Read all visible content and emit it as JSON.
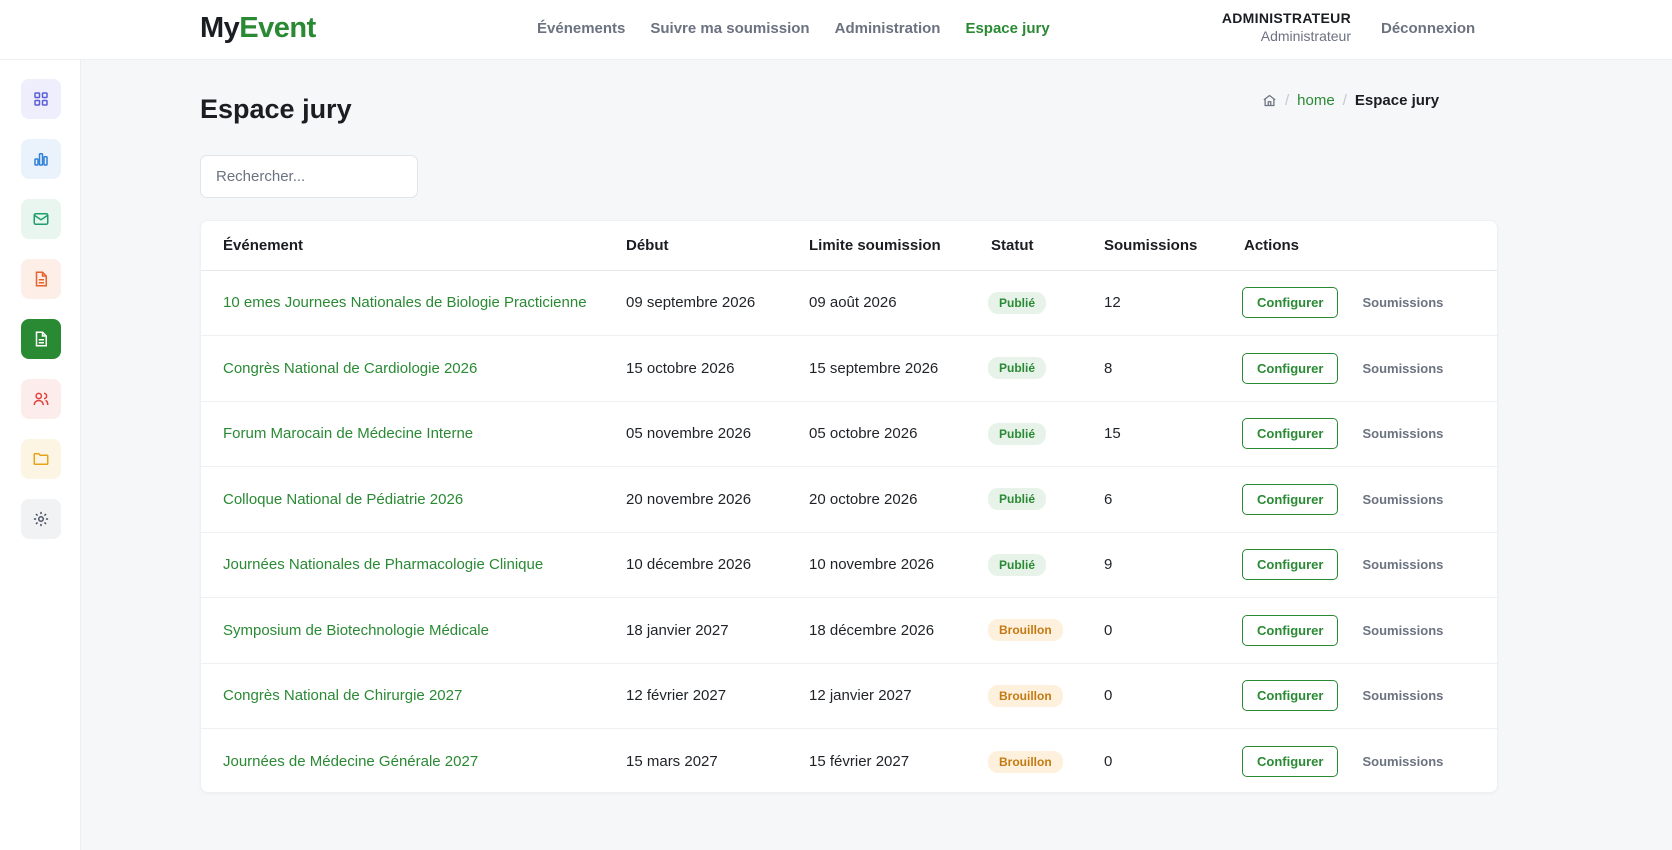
{
  "app": {
    "logo_part1": "My",
    "logo_part2": "Event"
  },
  "nav": {
    "items": [
      {
        "label": "Événements"
      },
      {
        "label": "Suivre ma soumission"
      },
      {
        "label": "Administration"
      },
      {
        "label": "Espace jury",
        "active": true
      }
    ]
  },
  "user": {
    "role_main": "ADMINISTRATEUR",
    "role_sub": "Administrateur",
    "logout": "Déconnexion"
  },
  "sidebar": {
    "items": [
      {
        "icon": "grid-icon",
        "color": "#5b5fd6",
        "bg": "#eeeefc"
      },
      {
        "icon": "bar-chart-icon",
        "color": "#2f80d8",
        "bg": "#eaf3fc"
      },
      {
        "icon": "mail-icon",
        "color": "#1e9e6a",
        "bg": "#e8f6ef"
      },
      {
        "icon": "document-icon",
        "color": "#e8622a",
        "bg": "#fdeee7"
      },
      {
        "icon": "document-icon",
        "color": "#ffffff",
        "bg": "#2a8a34",
        "active": true
      },
      {
        "icon": "users-icon",
        "color": "#e0403a",
        "bg": "#fdecec"
      },
      {
        "icon": "folder-icon",
        "color": "#e6a21a",
        "bg": "#fdf5e4"
      },
      {
        "icon": "gear-icon",
        "color": "#4b5563",
        "bg": "#f1f2f4"
      }
    ]
  },
  "page": {
    "title": "Espace jury"
  },
  "breadcrumb": {
    "home": "home",
    "current": "Espace jury"
  },
  "search": {
    "placeholder": "Rechercher..."
  },
  "table": {
    "headers": [
      "Événement",
      "Début",
      "Limite soumission",
      "Statut",
      "Soumissions",
      "Actions"
    ],
    "configure_label": "Configurer",
    "submissions_label": "Soumissions",
    "rows": [
      {
        "event": "10 emes Journees Nationales de Biologie Practicienne",
        "start": "09 septembre 2026",
        "deadline": "09 août 2026",
        "status": "Publié",
        "status_type": "pub",
        "submissions": "12"
      },
      {
        "event": "Congrès National de Cardiologie 2026",
        "start": "15 octobre 2026",
        "deadline": "15 septembre 2026",
        "status": "Publié",
        "status_type": "pub",
        "submissions": "8"
      },
      {
        "event": "Forum Marocain de Médecine Interne",
        "start": "05 novembre 2026",
        "deadline": "05 octobre 2026",
        "status": "Publié",
        "status_type": "pub",
        "submissions": "15"
      },
      {
        "event": "Colloque National de Pédiatrie 2026",
        "start": "20 novembre 2026",
        "deadline": "20 octobre 2026",
        "status": "Publié",
        "status_type": "pub",
        "submissions": "6"
      },
      {
        "event": "Journées Nationales de Pharmacologie Clinique",
        "start": "10 décembre 2026",
        "deadline": "10 novembre 2026",
        "status": "Publié",
        "status_type": "pub",
        "submissions": "9"
      },
      {
        "event": "Symposium de Biotechnologie Médicale",
        "start": "18 janvier 2027",
        "deadline": "18 décembre 2026",
        "status": "Brouillon",
        "status_type": "draft",
        "submissions": "0"
      },
      {
        "event": "Congrès National de Chirurgie 2027",
        "start": "12 février 2027",
        "deadline": "12 janvier 2027",
        "status": "Brouillon",
        "status_type": "draft",
        "submissions": "0"
      },
      {
        "event": "Journées de Médecine Générale 2027",
        "start": "15 mars 2027",
        "deadline": "15 février 2027",
        "status": "Brouillon",
        "status_type": "draft",
        "submissions": "0"
      }
    ]
  }
}
